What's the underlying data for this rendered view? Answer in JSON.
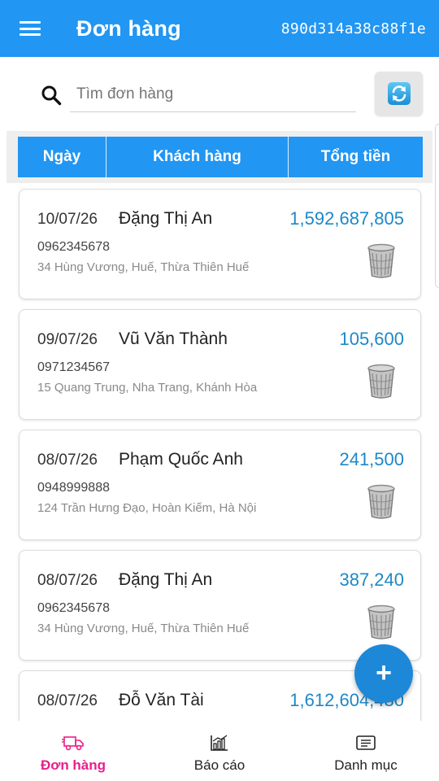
{
  "appbar": {
    "title": "Đơn hàng",
    "code": "890d314a38c88f1e"
  },
  "search": {
    "placeholder": "Tìm đơn hàng",
    "value": ""
  },
  "table_header": {
    "date": "Ngày",
    "customer": "Khách hàng",
    "total": "Tổng tiền"
  },
  "orders": [
    {
      "date": "10/07/26",
      "name": "Đặng Thị An",
      "total": "1,592,687,805",
      "phone": "0962345678",
      "address": "34 Hùng Vương, Huế, Thừa Thiên Huế"
    },
    {
      "date": "09/07/26",
      "name": "Vũ Văn Thành",
      "total": "105,600",
      "phone": "0971234567",
      "address": "15 Quang Trung, Nha Trang, Khánh Hòa"
    },
    {
      "date": "08/07/26",
      "name": "Phạm Quốc Anh",
      "total": "241,500",
      "phone": "0948999888",
      "address": "124 Trần Hưng Đạo, Hoàn Kiếm, Hà Nội"
    },
    {
      "date": "08/07/26",
      "name": "Đặng Thị An",
      "total": "387,240",
      "phone": "0962345678",
      "address": "34 Hùng Vương, Huế, Thừa Thiên Huế"
    },
    {
      "date": "08/07/26",
      "name": "Đỗ Văn Tài",
      "total": "1,612,604,480",
      "phone": "",
      "address": ""
    }
  ],
  "fab": {
    "label": "+"
  },
  "bottom_nav": {
    "items": [
      {
        "label": "Đơn hàng",
        "icon": "delivery-truck-icon",
        "active": true
      },
      {
        "label": "Báo cáo",
        "icon": "bar-chart-icon",
        "active": false
      },
      {
        "label": "Danh mục",
        "icon": "list-icon",
        "active": false
      }
    ]
  },
  "colors": {
    "primary": "#2196f3",
    "total_text": "#1e88c8",
    "fab": "#1e88d8",
    "nav_active": "#e91e8c"
  }
}
